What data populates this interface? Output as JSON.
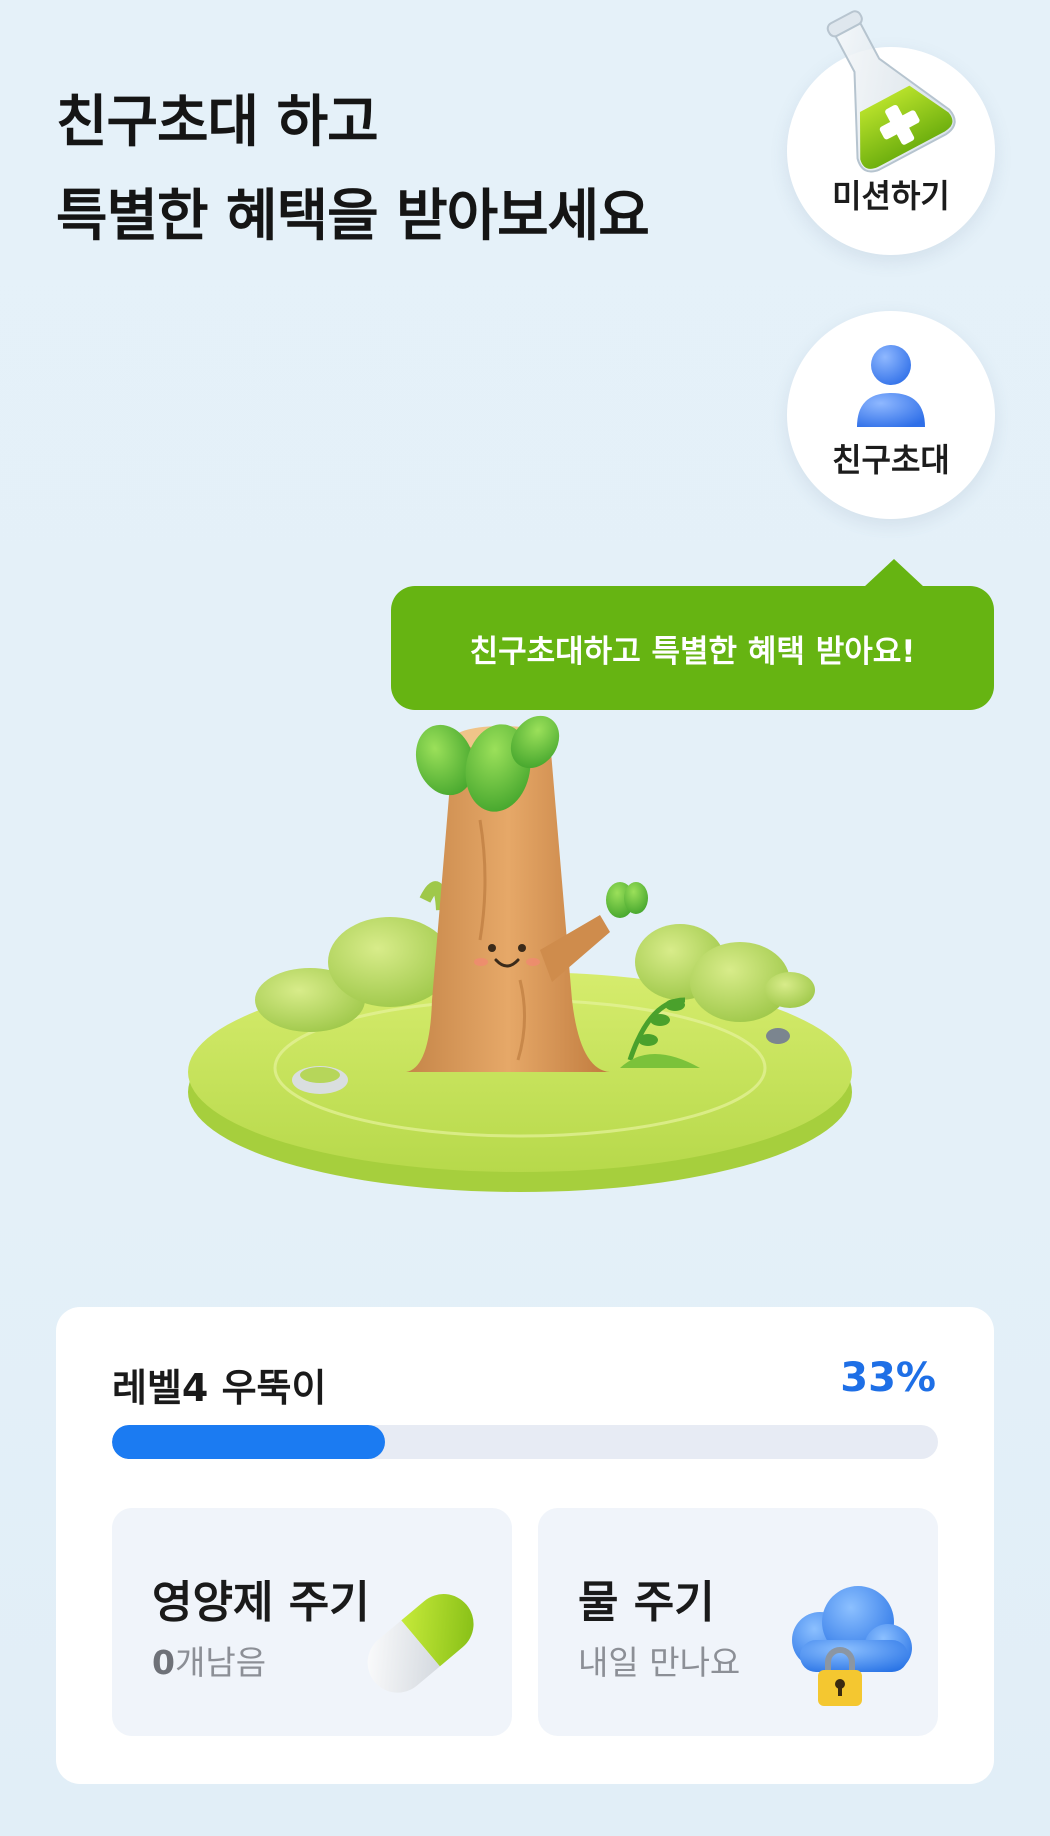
{
  "header": {
    "line1": "친구초대 하고",
    "line2": "특별한 혜택을 받아보세요"
  },
  "side_buttons": {
    "mission": {
      "label": "미션하기",
      "icon": "flask-plus-icon"
    },
    "invite": {
      "label": "친구초대",
      "icon": "person-icon"
    }
  },
  "tooltip": {
    "text": "친구초대하고 특별한 혜택 받아요!"
  },
  "scene": {
    "character": "tree-character-illustration"
  },
  "level_card": {
    "title": "레벨4 우뚝이",
    "percent_label": "33%",
    "progress": 0.33,
    "actions": [
      {
        "title": "영양제 주기",
        "count": "0",
        "sub_suffix": "개남음",
        "icon": "pill-icon"
      },
      {
        "title": "물 주기",
        "sub": "내일 만나요",
        "icon": "locked-cloud-icon"
      }
    ]
  },
  "colors": {
    "background": "#e5f1f9",
    "accent_green": "#66b412",
    "progress_blue": "#1b7bf2",
    "percent_blue": "#1e6fe6"
  }
}
